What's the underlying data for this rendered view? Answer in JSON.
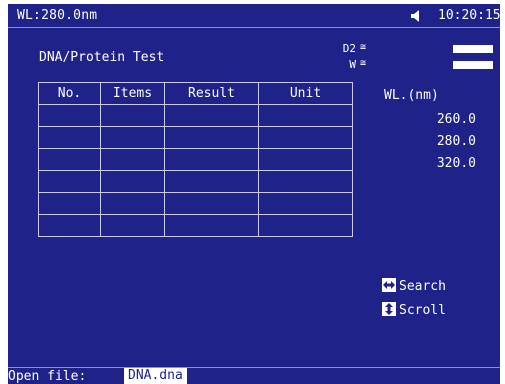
{
  "topbar": {
    "wavelength": "WL:280.0nm",
    "speaker_icon": "speaker-icon",
    "time": "10:20:15"
  },
  "lamps": [
    {
      "name": "D2",
      "symbol": "≅",
      "status": "on"
    },
    {
      "name": "W",
      "symbol": "≅",
      "status": "on"
    }
  ],
  "title": "DNA/Protein Test",
  "table": {
    "headers": [
      "No.",
      "Items",
      "Result",
      "Unit"
    ],
    "rows": [
      [
        "",
        "",
        "",
        ""
      ],
      [
        "",
        "",
        "",
        ""
      ],
      [
        "",
        "",
        "",
        ""
      ],
      [
        "",
        "",
        "",
        ""
      ],
      [
        "",
        "",
        "",
        ""
      ],
      [
        "",
        "",
        "",
        ""
      ]
    ]
  },
  "wavelengths": {
    "header": "WL.(nm)",
    "values": [
      "260.0",
      "280.0",
      "320.0"
    ]
  },
  "hints": {
    "search": {
      "icon": "left-right-arrow-icon",
      "label": "Search"
    },
    "scroll": {
      "icon": "up-down-arrow-icon",
      "label": "Scroll"
    }
  },
  "status": {
    "label": "Open file:",
    "filename": "DNA.dna"
  },
  "colors": {
    "background": "#1f2288",
    "foreground": "#ffffff"
  }
}
